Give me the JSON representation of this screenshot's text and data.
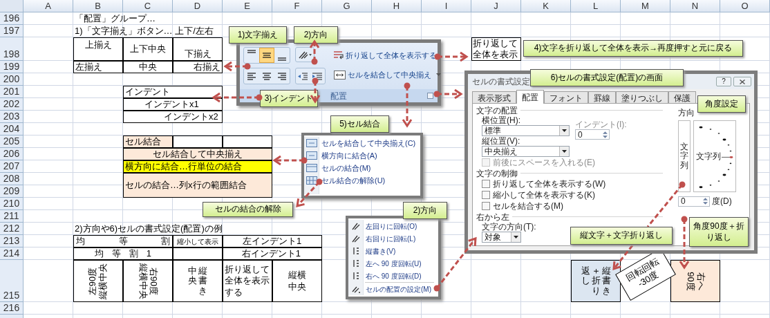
{
  "sheet": {
    "columns": [
      "A",
      "B",
      "C",
      "D",
      "E",
      "F",
      "G",
      "H",
      "I",
      "J",
      "K",
      "L",
      "M",
      "N",
      "O"
    ],
    "rows": [
      "196",
      "197",
      "198",
      "199",
      "200",
      "201",
      "202",
      "203",
      "204",
      "205",
      "206",
      "207",
      "208",
      "209",
      "210",
      "211",
      "212",
      "213",
      "214",
      "215",
      "216"
    ],
    "cells": [
      {
        "kind": "text",
        "text": "「配置」グループ…"
      },
      {
        "kind": "text",
        "text": "1)「文字揃え」ボタン… 上下/左右"
      },
      {
        "kind": "text",
        "text": "上揃え"
      },
      {
        "kind": "text",
        "text": "上下中央"
      },
      {
        "kind": "text",
        "text": "下揃え"
      },
      {
        "kind": "text",
        "text": "左揃え"
      },
      {
        "kind": "text",
        "text": "中央"
      },
      {
        "kind": "text",
        "text": "右揃え"
      },
      {
        "kind": "text",
        "text": "インデント"
      },
      {
        "kind": "text",
        "text": "インデントx1"
      },
      {
        "kind": "text",
        "text": "インデントx2"
      },
      {
        "kind": "text",
        "text": "セル結合",
        "color": "#fde9d9"
      },
      {
        "kind": "text",
        "text": "セル結合して中央揃え",
        "color": "#fde9d9"
      },
      {
        "kind": "text",
        "text": "横方向に結合…行単位の結合",
        "color": "#ffff00"
      },
      {
        "kind": "text",
        "text": "セルの結合…列x行の範囲結合",
        "color": "#fde9d9"
      },
      {
        "kind": "text",
        "text": "2)方向や6)セルの書式設定(配置)の例"
      },
      {
        "kind": "distributed",
        "text": "均等割"
      },
      {
        "kind": "text",
        "text": "縮小して表示"
      },
      {
        "kind": "text",
        "text": "左インデント1"
      },
      {
        "kind": "distributed",
        "text": "均等割1"
      },
      {
        "kind": "text",
        "text": "右インデント1"
      },
      {
        "kind": "rotated-left",
        "lines": [
          "左90度",
          "縦横中央"
        ]
      },
      {
        "kind": "rotated-right",
        "lines": [
          "右90度",
          "縦横中央"
        ]
      },
      {
        "kind": "vertical",
        "lines": [
          "中央",
          "縦書き"
        ]
      },
      {
        "kind": "text",
        "text": "折り返して全体を表示する"
      },
      {
        "kind": "text",
        "text": "縦横中央"
      },
      {
        "kind": "text",
        "text": "折り返して全体を表示"
      },
      {
        "kind": "vertical",
        "lines": [
          "返し",
          "＋折り",
          "縦書き"
        ],
        "color": "#dce6f1"
      },
      {
        "kind": "rotated-right",
        "lines": [
          "右へ",
          "90度"
        ],
        "color": "#fde9d9"
      },
      {
        "kind": "tilted",
        "lines": [
          "回転回転",
          "-30度"
        ]
      }
    ]
  },
  "ribbon": {
    "align_buttons": [
      {
        "kind": "top",
        "selected": false
      },
      {
        "kind": "middle",
        "selected": true
      },
      {
        "kind": "bottom",
        "selected": false
      },
      {
        "kind": "left",
        "selected": false
      },
      {
        "kind": "center",
        "selected": false
      },
      {
        "kind": "right",
        "selected": false
      }
    ],
    "wrap_text": "折り返して全体を表示する",
    "merge_center": "セルを結合して中央揃え",
    "group_label": "配置"
  },
  "callouts": [
    "1)文字揃え",
    "2)方向",
    "4)文字を折り返して全体を表示→再度押すと元に戻る",
    "6)セルの書式設定(配置)の画面",
    "3)インデント",
    "角度設定",
    "5)セル結合",
    "セルの結合の解除",
    "2)方向",
    "縦文字＋文字折り返し",
    "角度90度＋折り返し"
  ],
  "dialog": {
    "title": "セルの書式設定",
    "help": "?",
    "tabs": [
      {
        "label": "表示形式",
        "selected": false
      },
      {
        "label": "配置",
        "selected": true
      },
      {
        "label": "フォント",
        "selected": false
      },
      {
        "label": "罫線",
        "selected": false
      },
      {
        "label": "塗りつぶし",
        "selected": false
      },
      {
        "label": "保護",
        "selected": false
      }
    ],
    "text_alignment": {
      "heading": "文字の配置",
      "horizontal": {
        "label": "横位置(H):",
        "value": "標準"
      },
      "vertical": {
        "label": "縦位置(V):",
        "value": "中央揃え"
      },
      "indent": {
        "label": "インデント(I):",
        "value": "0",
        "disabled": true
      },
      "distributed": {
        "label": "前後にスペースを入れる(E)",
        "checked": false,
        "disabled": true
      }
    },
    "text_control": {
      "heading": "文字の制御",
      "options": [
        {
          "label": "折り返して全体を表示する(W)",
          "checked": false,
          "disabled": false
        },
        {
          "label": "縮小して全体を表示する(K)",
          "checked": false,
          "disabled": false
        },
        {
          "label": "セルを結合する(M)",
          "checked": false,
          "disabled": false
        }
      ]
    },
    "right_to_left": {
      "heading": "右から左",
      "label": "文字の方向(T):",
      "value": "対象"
    },
    "orientation": {
      "heading": "方向",
      "vertical_text": "文字列",
      "dial_text": "文字列",
      "degrees": "0",
      "degrees_label": "度(D)"
    }
  },
  "merge_menu": {
    "items": [
      "セルを結合して中央揃え(C)",
      "横方向に結合(A)",
      "セルの結合(M)",
      "セル結合の解除(U)"
    ]
  },
  "direction_menu": {
    "items": [
      "左回りに回転(O)",
      "右回りに回転(L)",
      "縦書き(V)",
      "左へ 90 度回転(U)",
      "右へ 90 度回転(D)",
      "セルの配置の設定(M)"
    ]
  }
}
